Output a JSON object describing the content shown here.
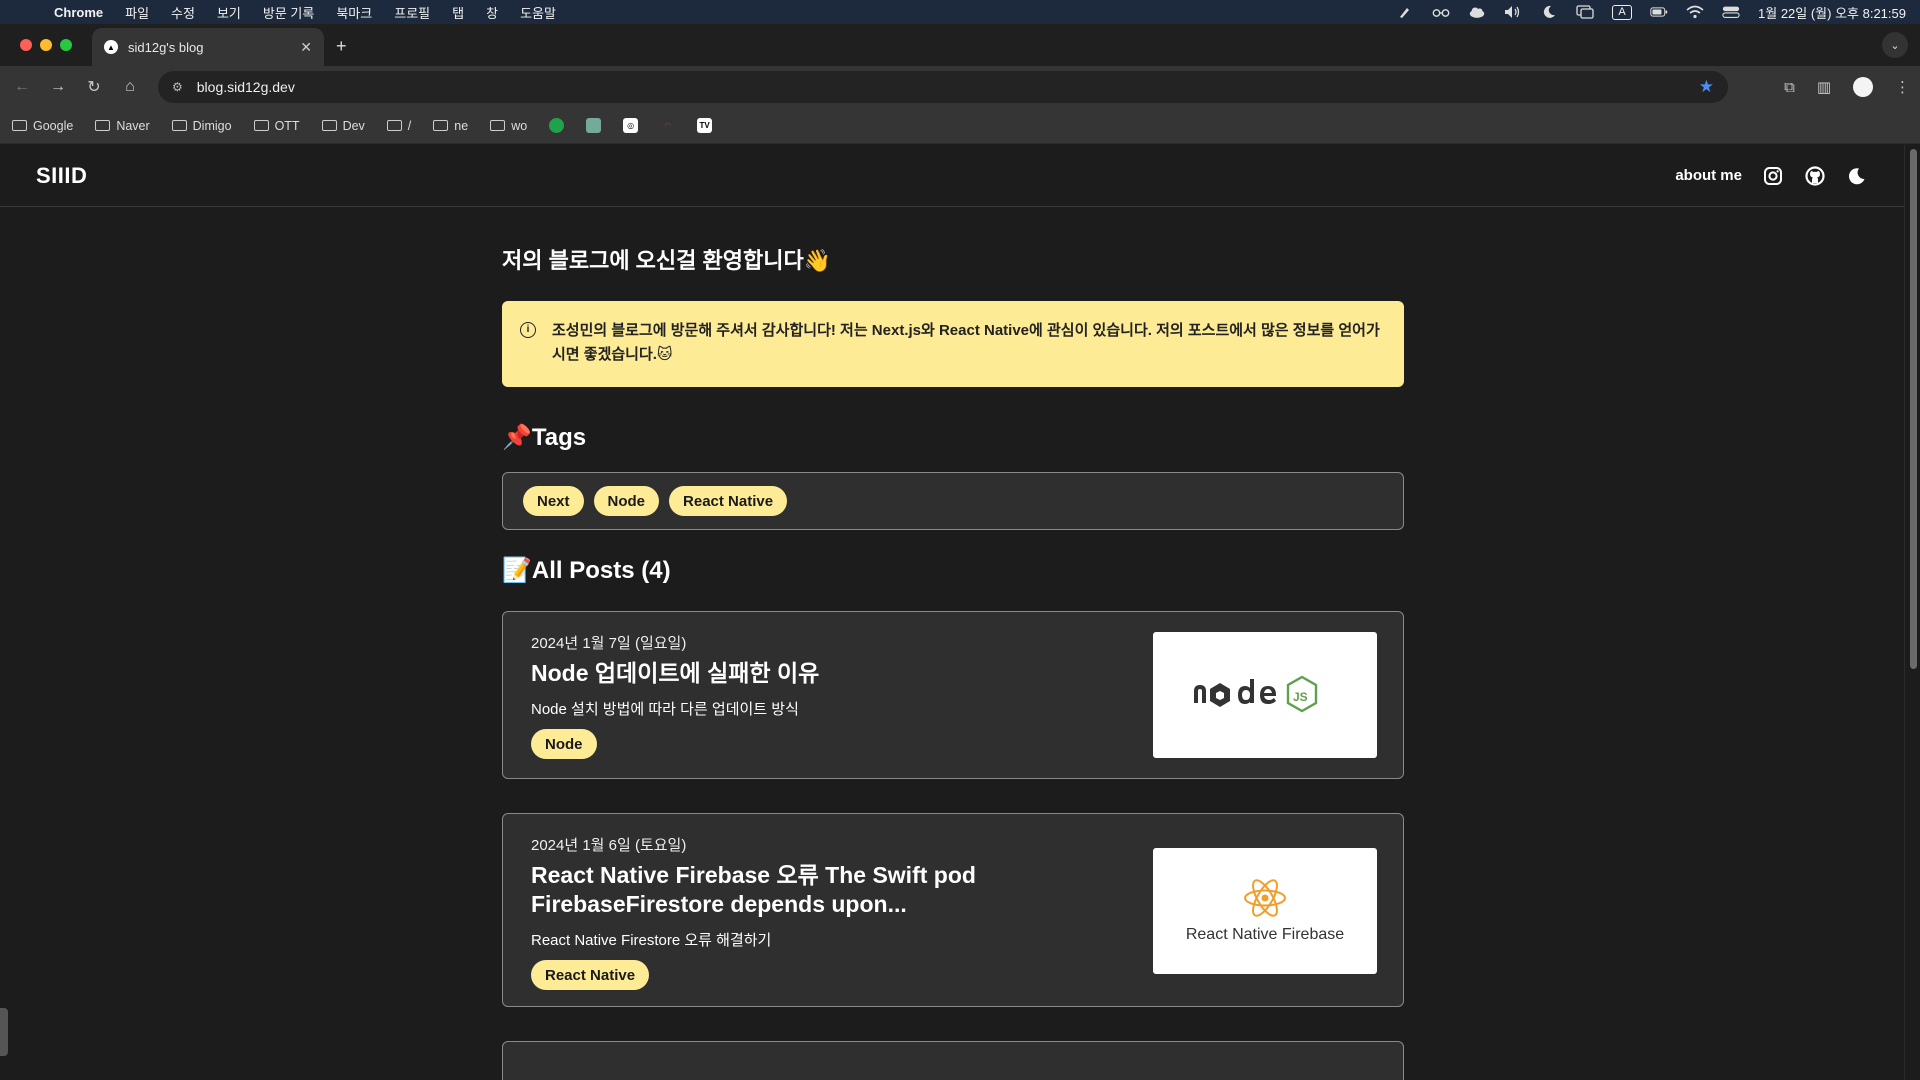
{
  "menubar": {
    "app": "Chrome",
    "items": [
      "파일",
      "수정",
      "보기",
      "방문 기록",
      "북마크",
      "프로필",
      "탭",
      "창",
      "도움말"
    ],
    "input_source": "A",
    "datetime": "1월 22일 (월) 오후 8:21:59"
  },
  "browser": {
    "tab_title": "sid12g's blog",
    "url": "blog.sid12g.dev",
    "bookmarks": [
      "Google",
      "Naver",
      "Dimigo",
      "OTT",
      "Dev",
      "/",
      "ne",
      "wo"
    ]
  },
  "site": {
    "logo": "SIIID",
    "nav_about": "about me"
  },
  "main": {
    "welcome": "저의 블로그에 오신걸 환영합니다👋",
    "notice": "조성민의 블로그에 방문해 주셔서 감사합니다! 저는 Next.js와 React Native에 관심이 있습니다. 저의 포스트에서 많은 정보를 얻어가시면 좋겠습니다.🐱",
    "tags_title": "📌Tags",
    "tags": [
      "Next",
      "Node",
      "React Native"
    ],
    "posts_title": "📝All Posts (4)"
  },
  "posts": [
    {
      "date": "2024년 1월 7일 (일요일)",
      "title": "Node 업데이트에 실패한 이유",
      "desc": "Node 설치 방법에 따라 다른 업데이트 방식",
      "tag": "Node",
      "thumb_text": ""
    },
    {
      "date": "2024년 1월 6일 (토요일)",
      "title": "React Native Firebase 오류 The Swift pod FirebaseFirestore depends upon...",
      "desc": "React Native Firestore 오류 해결하기",
      "tag": "React Native",
      "thumb_text": "React Native Firebase"
    }
  ],
  "colors": {
    "accent_yellow": "#fdeb95",
    "background": "#1c1c1c",
    "card": "#2f2f2f",
    "star": "#4a8ef0"
  }
}
